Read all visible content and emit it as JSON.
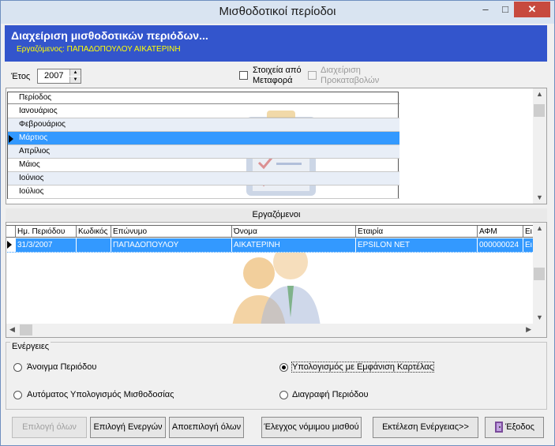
{
  "window": {
    "title": "Μισθοδοτικοί περίοδοι",
    "minimize_label": "–",
    "maximize_label": "□",
    "close_label": "✕"
  },
  "header": {
    "title": "Διαχείριση μισθοδοτικών περιόδων...",
    "subtitle": "Εργαζόμενος: ΠΑΠΑΔΟΠΟΥΛΟΥ ΑΙΚΑΤΕΡΙΝΗ",
    "color": "#3355cc"
  },
  "year": {
    "label": "Έτος",
    "value": "2007"
  },
  "options": {
    "transfer_label_1": "Στοιχεία από",
    "transfer_label_2": "Μεταφορά",
    "advances_label_1": "Διαχείριση",
    "advances_label_2": "Προκαταβολών"
  },
  "periods": {
    "column": "Περίοδος",
    "rows": [
      "Ιανουάριος",
      "Φεβρουάριος",
      "Μάρτιος",
      "Απρίλιος",
      "Μάιος",
      "Ιούνιος",
      "Ιούλιος"
    ],
    "selected": "Μάρτιος"
  },
  "employees": {
    "section_label": "Εργαζόμενοι",
    "columns": [
      "Ημ. Περιόδου",
      "Κωδικός",
      "Επώνυμο",
      "Όνομα",
      "Εταιρία",
      "ΑΦΜ",
      "Ει"
    ],
    "rows": [
      [
        "31/3/2007",
        "",
        "ΠΑΠΑΔΟΠΟΥΛΟΥ",
        "ΑΙΚΑΤΕΡΙΝΗ",
        "EPSILON NET",
        "000000024",
        "Ει"
      ]
    ]
  },
  "actions": {
    "legend": "Ενέργειες",
    "open_period": "Άνοιγμα Περιόδου",
    "auto_calc": "Αυτόματος Υπολογισμός Μισθοδοσίας",
    "calc_show": "Υπολογισμός με Εμφάνιση Καρτέλας",
    "delete_period": "Διαγραφή Περιόδου",
    "selected": "calc_show"
  },
  "buttons": {
    "select_all": "Επιλογή όλων",
    "select_active": "Επιλογή Ενεργών",
    "deselect_all": "Αποεπιλογή όλων",
    "check_min_wage": "Έλεγχος νόμιμου μισθού",
    "execute": "Εκτέλεση Ενέργειας>>",
    "exit": "Έξοδος"
  },
  "colors": {
    "selection": "#3399ff",
    "title_bar": "#d9e4f1",
    "close": "#c74a3e",
    "subtitle": "#ffff00"
  }
}
